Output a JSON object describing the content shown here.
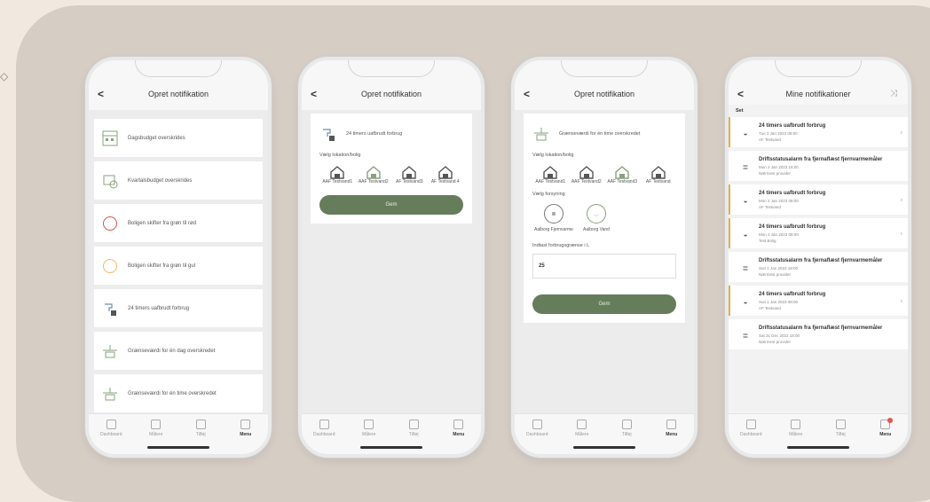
{
  "side_arrow": "◇",
  "phones": {
    "p1": {
      "title": "Opret notifikation",
      "items": [
        {
          "label": "Dagsbudget overskrides"
        },
        {
          "label": "Kvartalsbudget overskrides"
        },
        {
          "label": "Boligen skifter fra grøn til rød"
        },
        {
          "label": "Boligen skifter fra grøn til gul"
        },
        {
          "label": "24 timers uafbrudt forbrug"
        },
        {
          "label": "Grænseværdi for én dag overskredet"
        },
        {
          "label": "Grænseværdi for én time overskredet"
        }
      ]
    },
    "p2": {
      "title": "Opret notifikation",
      "card_title": "24 timers uafbrudt forbrug",
      "choose_location": "Vælg lokation/bolig",
      "locations": [
        "AAF Testvand1",
        "AAF Testvand2",
        "AF Testvand3",
        "AF Testvand 4"
      ],
      "save": "Gem"
    },
    "p3": {
      "title": "Opret notifikation",
      "card_title": "Grænseværdi for én time overskredet",
      "choose_location": "Vælg lokation/bolig",
      "locations": [
        "AAF Testvand1",
        "AAF Testvand2",
        "AAF Testvand3",
        "AF Testvand"
      ],
      "choose_supply": "Vælg forsyning",
      "supplies": [
        "Aalborg Fjernvarme",
        "Aalborg Vand"
      ],
      "threshold_label": "Indtast forbrugsgrænse i L",
      "threshold_value": "25",
      "save": "Gem"
    },
    "p4": {
      "title": "Mine notifikationer",
      "section": "Set",
      "notifications": [
        {
          "title": "24 timers uafbrudt forbrug",
          "date": "Tue 3 Jan 2023 08:00",
          "meta": "AF Testvand",
          "accent": true
        },
        {
          "title": "Driftsstatusalarm fra fjernaflæst fjernvarmemåler",
          "date": "Mon 2 Jan 2023 18:00",
          "meta": "Nærmest provider",
          "accent": false
        },
        {
          "title": "24 timers uafbrudt forbrug",
          "date": "Mon 2 Jan 2023 08:00",
          "meta": "AF Testvand",
          "accent": true
        },
        {
          "title": "24 timers uafbrudt forbrug",
          "date": "Mon 2 Jan 2023 08:00",
          "meta": "Test Bolig",
          "accent": true
        },
        {
          "title": "Driftsstatusalarm fra fjernaflæst fjernvarmemåler",
          "date": "Sun 1 Jan 2023 18:00",
          "meta": "Nærmest provider",
          "accent": false
        },
        {
          "title": "24 timers uafbrudt forbrug",
          "date": "Sun 1 Jan 2023 08:00",
          "meta": "AF Testvand",
          "accent": true
        },
        {
          "title": "Driftsstatusalarm fra fjernaflæst fjernvarmemåler",
          "date": "Sat 31 Dec 2022 18:00",
          "meta": "Nærmest provider",
          "accent": false
        }
      ]
    }
  },
  "tabbar": {
    "dashboard": "Dashboard",
    "maalere": "Målere",
    "tilfoej": "Tilføj",
    "menu": "Menu"
  },
  "colors": {
    "accent_green": "#667d5b",
    "accent_yellow": "#e0b24a",
    "danger": "#d9534f",
    "warning": "#f0b96a"
  }
}
